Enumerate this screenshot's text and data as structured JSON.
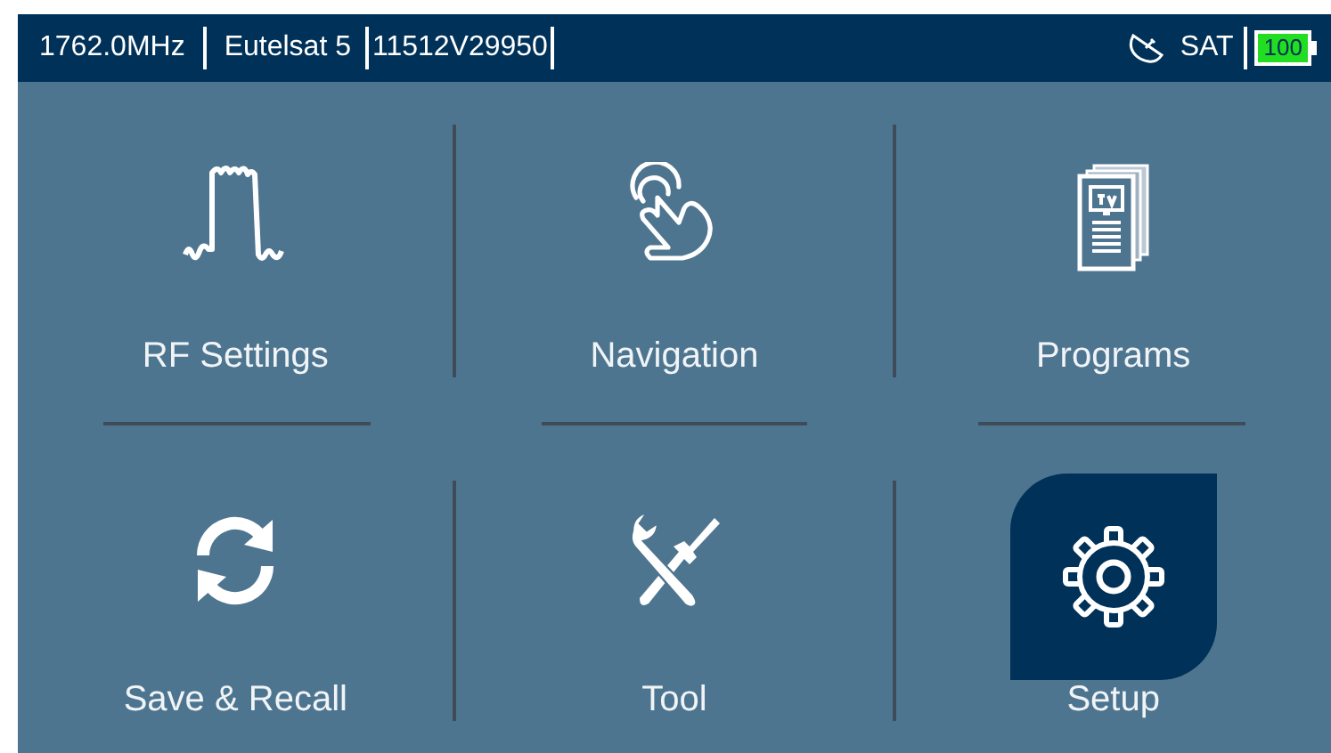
{
  "status_bar": {
    "frequency": "1762.0MHz",
    "satellite": "Eutelsat 5",
    "transponder": "11512V29950",
    "mode": "SAT",
    "battery": "100"
  },
  "menu": [
    {
      "label": "RF Settings",
      "kind": "spectrum",
      "selected": false
    },
    {
      "label": "Navigation",
      "kind": "hand",
      "selected": false
    },
    {
      "label": "Programs",
      "kind": "guide",
      "selected": false
    },
    {
      "label": "Save & Recall",
      "kind": "refresh",
      "selected": false
    },
    {
      "label": "Tool",
      "kind": "tools",
      "selected": false
    },
    {
      "label": "Setup",
      "kind": "gear",
      "selected": true
    }
  ]
}
